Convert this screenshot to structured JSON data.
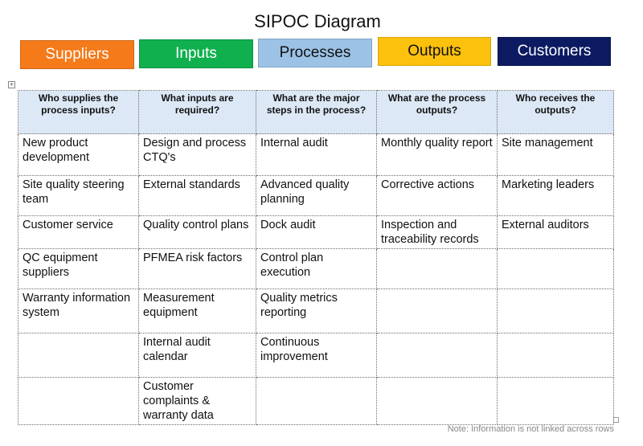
{
  "title": "SIPOC Diagram",
  "categories": [
    {
      "label": "Suppliers",
      "bg": "#f57a1a",
      "fg": "#ffffff"
    },
    {
      "label": "Inputs",
      "bg": "#10b04f",
      "fg": "#ffffff"
    },
    {
      "label": "Processes",
      "bg": "#9cc2e6",
      "fg": "#111111"
    },
    {
      "label": "Outputs",
      "bg": "#fcc10c",
      "fg": "#111111"
    },
    {
      "label": "Customers",
      "bg": "#0c1a62",
      "fg": "#ffffff"
    }
  ],
  "table": {
    "move_handle_icon": "move-cross-icon",
    "headers": [
      "Who supplies the process inputs?",
      "What inputs are required?",
      "What are the major steps in the process?",
      "What are the process outputs?",
      "Who receives the outputs?"
    ],
    "rows": [
      [
        "New product development",
        "Design and process CTQ's",
        "Internal audit",
        "Monthly quality report",
        "Site management"
      ],
      [
        "Site quality steering team",
        "External standards",
        "Advanced quality planning",
        "Corrective actions",
        "Marketing leaders"
      ],
      [
        "Customer service",
        "Quality control plans",
        "Dock audit",
        "Inspection and traceability records",
        "External auditors"
      ],
      [
        "QC equipment suppliers",
        "PFMEA risk factors",
        "Control plan execution",
        "",
        ""
      ],
      [
        "Warranty information system",
        "Measurement equipment",
        "Quality metrics reporting",
        "",
        ""
      ],
      [
        "",
        "Internal audit calendar",
        "Continuous improvement",
        "",
        ""
      ],
      [
        "",
        "Customer complaints & warranty data",
        "",
        "",
        ""
      ]
    ]
  },
  "note": "Note:  Information is not linked across rows"
}
